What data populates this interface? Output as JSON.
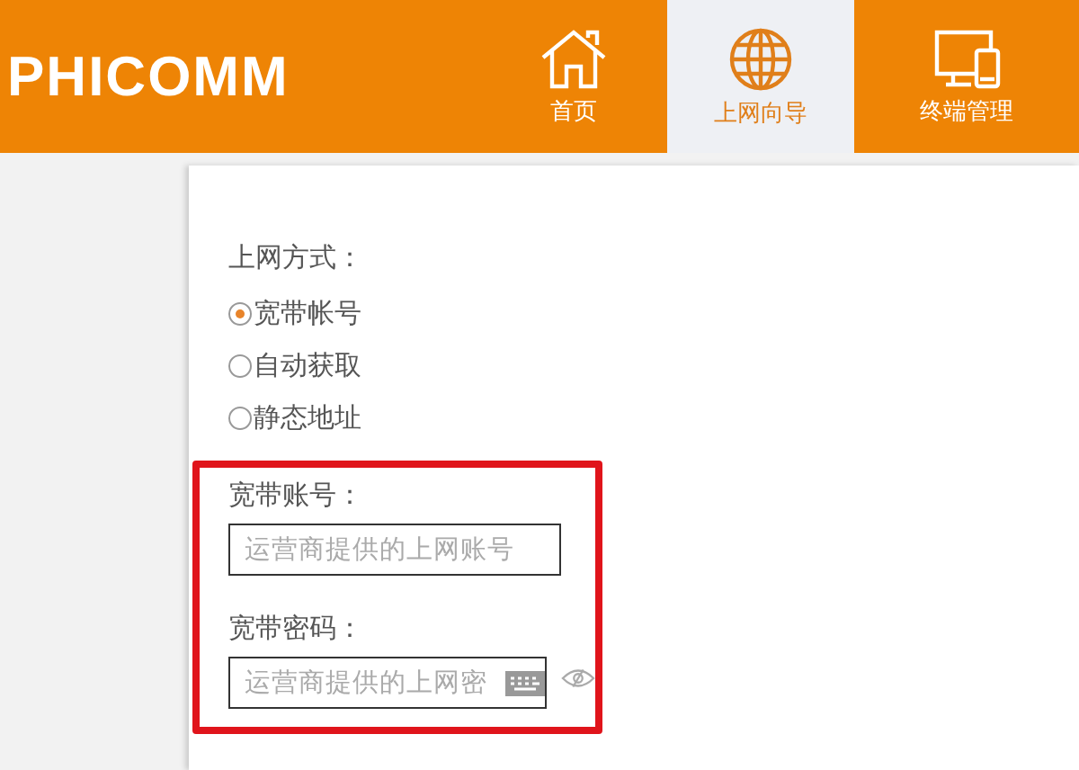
{
  "header": {
    "logo": "PHICOMM",
    "nav": [
      {
        "label": "首页",
        "selected": false
      },
      {
        "label": "上网向导",
        "selected": true
      },
      {
        "label": "终端管理",
        "selected": false
      }
    ]
  },
  "form": {
    "method_label": "上网方式：",
    "methods": [
      {
        "label": "宽带帐号",
        "selected": true
      },
      {
        "label": "自动获取",
        "selected": false
      },
      {
        "label": "静态地址",
        "selected": false
      }
    ],
    "account": {
      "label": "宽带账号：",
      "placeholder": "运营商提供的上网账号"
    },
    "password": {
      "label": "宽带密码：",
      "placeholder": "运营商提供的上网密"
    }
  }
}
